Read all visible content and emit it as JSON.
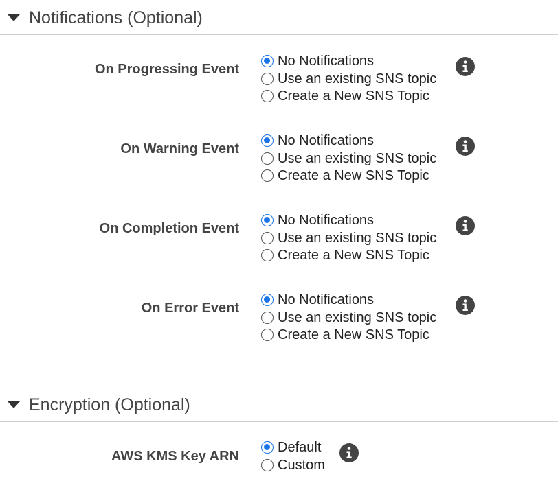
{
  "notifications": {
    "title": "Notifications (Optional)",
    "events": [
      {
        "label": "On Progressing Event",
        "options": [
          "No Notifications",
          "Use an existing SNS topic",
          "Create a New SNS Topic"
        ],
        "selected": 0
      },
      {
        "label": "On Warning Event",
        "options": [
          "No Notifications",
          "Use an existing SNS topic",
          "Create a New SNS Topic"
        ],
        "selected": 0
      },
      {
        "label": "On Completion Event",
        "options": [
          "No Notifications",
          "Use an existing SNS topic",
          "Create a New SNS Topic"
        ],
        "selected": 0
      },
      {
        "label": "On Error Event",
        "options": [
          "No Notifications",
          "Use an existing SNS topic",
          "Create a New SNS Topic"
        ],
        "selected": 0
      }
    ]
  },
  "encryption": {
    "title": "Encryption (Optional)",
    "kms": {
      "label": "AWS KMS Key ARN",
      "options": [
        "Default",
        "Custom"
      ],
      "selected": 0
    }
  },
  "colors": {
    "accent": "#1a73e8",
    "label_text": "#444444",
    "info_icon": "#444444"
  }
}
